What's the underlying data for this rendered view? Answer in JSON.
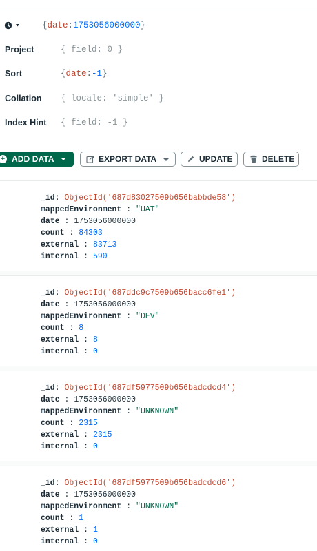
{
  "query": {
    "filter": {
      "open": "{",
      "key": "date",
      "sep": ":",
      "num": "1753056000000",
      "close": "}"
    },
    "project": {
      "label": "Project",
      "value": "{ field: 0 }"
    },
    "sort": {
      "label": "Sort",
      "open": "{",
      "key": "date",
      "sep": ":",
      "num": "-1",
      "close": "}"
    },
    "collation": {
      "label": "Collation",
      "value": "{ locale: 'simple' }"
    },
    "index_hint": {
      "label": "Index Hint",
      "value": "{ field: -1 }"
    }
  },
  "toolbar": {
    "add_data": "ADD DATA",
    "export_data": "EXPORT DATA",
    "update": "UPDATE",
    "delete": "DELETE"
  },
  "documents": [
    {
      "fields": [
        {
          "name": "_id",
          "sep": ": ",
          "value": "ObjectId('687d83027509b656babbde58')",
          "kind": "oid"
        },
        {
          "name": "mappedEnvironment",
          "sep": " : ",
          "value": "\"UAT\"",
          "kind": "str"
        },
        {
          "name": "date",
          "sep": " : ",
          "value": "1753056000000",
          "kind": "plain"
        },
        {
          "name": "count",
          "sep": " : ",
          "value": "84303",
          "kind": "num"
        },
        {
          "name": "external",
          "sep": " : ",
          "value": "83713",
          "kind": "num"
        },
        {
          "name": "internal",
          "sep": " : ",
          "value": "590",
          "kind": "num"
        }
      ]
    },
    {
      "fields": [
        {
          "name": "_id",
          "sep": ": ",
          "value": "ObjectId('687ddc9c7509b656bacc6fe1')",
          "kind": "oid"
        },
        {
          "name": "date",
          "sep": " : ",
          "value": "1753056000000",
          "kind": "plain"
        },
        {
          "name": "mappedEnvironment",
          "sep": " : ",
          "value": "\"DEV\"",
          "kind": "str"
        },
        {
          "name": "count",
          "sep": " : ",
          "value": "8",
          "kind": "num"
        },
        {
          "name": "external",
          "sep": " : ",
          "value": "8",
          "kind": "num"
        },
        {
          "name": "internal",
          "sep": " : ",
          "value": "0",
          "kind": "num"
        }
      ]
    },
    {
      "fields": [
        {
          "name": "_id",
          "sep": ": ",
          "value": "ObjectId('687df5977509b656badcdcd4')",
          "kind": "oid"
        },
        {
          "name": "date",
          "sep": " : ",
          "value": "1753056000000",
          "kind": "plain"
        },
        {
          "name": "mappedEnvironment",
          "sep": " : ",
          "value": "\"UNKNOWN\"",
          "kind": "str"
        },
        {
          "name": "count",
          "sep": " : ",
          "value": "2315",
          "kind": "num"
        },
        {
          "name": "external",
          "sep": " : ",
          "value": "2315",
          "kind": "num"
        },
        {
          "name": "internal",
          "sep": " : ",
          "value": "0",
          "kind": "num"
        }
      ]
    },
    {
      "fields": [
        {
          "name": "_id",
          "sep": ": ",
          "value": "ObjectId('687df5977509b656badcdcd6')",
          "kind": "oid"
        },
        {
          "name": "date",
          "sep": " : ",
          "value": "1753056000000",
          "kind": "plain"
        },
        {
          "name": "mappedEnvironment",
          "sep": " : ",
          "value": "\"UNKNOWN\"",
          "kind": "str"
        },
        {
          "name": "count",
          "sep": " : ",
          "value": "1",
          "kind": "num"
        },
        {
          "name": "external",
          "sep": " : ",
          "value": "1",
          "kind": "num"
        },
        {
          "name": "internal",
          "sep": " : ",
          "value": "0",
          "kind": "num"
        }
      ]
    }
  ],
  "icons": {
    "history": "clock-icon",
    "add": "plus-circle-icon",
    "export": "export-icon",
    "update": "pencil-icon",
    "delete": "trash-icon"
  },
  "colors": {
    "primary": "#00684a",
    "key": "#c2452d",
    "number": "#016bf8",
    "string": "#00684a"
  }
}
